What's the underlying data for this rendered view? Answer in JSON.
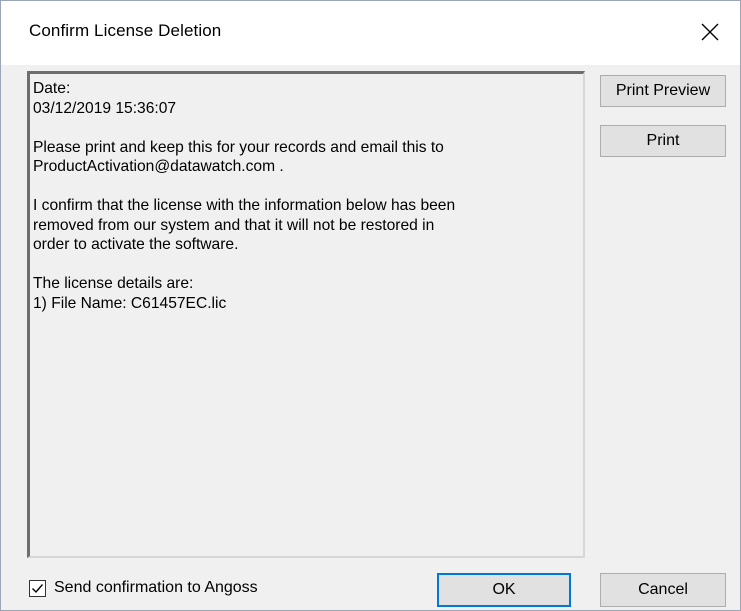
{
  "window": {
    "title": "Confirm License Deletion"
  },
  "message": {
    "text": "Date:\n03/12/2019 15:36:07\n\nPlease print and keep this for your records and email this to\nProductActivation@datawatch.com .\n\nI confirm that the license with the information below has been\nremoved from our system and that it will not be restored in\norder to activate the software.\n\nThe license details are:\n1) File Name: C61457EC.lic"
  },
  "buttons": {
    "print_preview": "Print Preview",
    "print": "Print",
    "ok": "OK",
    "cancel": "Cancel"
  },
  "send_confirmation": {
    "label": "Send confirmation to Angoss",
    "checked": true
  },
  "icons": {
    "close": "close-icon",
    "check": "checkmark-icon"
  },
  "colors": {
    "default_button_border": "#0078d7",
    "titlebar_bg": "#ffffff",
    "dialog_bg": "#f0f0f0"
  }
}
